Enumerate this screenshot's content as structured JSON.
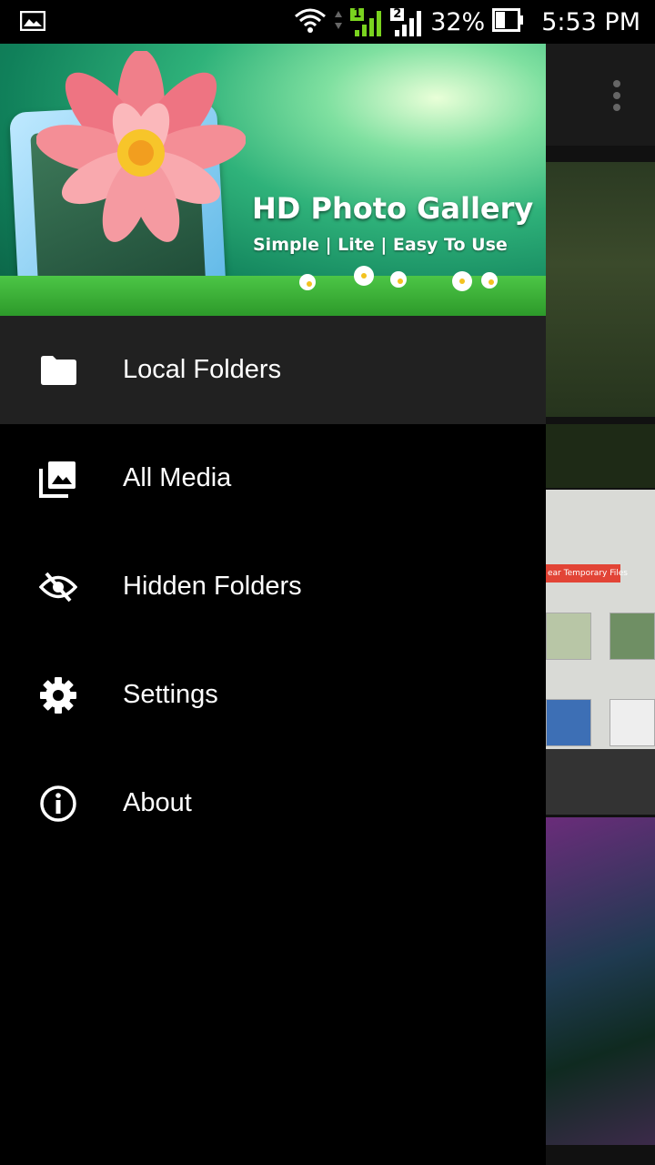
{
  "status_bar": {
    "notification_icon": "image-icon",
    "wifi_icon": "wifi-icon",
    "sim1_label": "1",
    "sim2_label": "2",
    "battery_percent": "32%",
    "time": "5:53 PM",
    "sim1_color": "#7ad31f"
  },
  "drawer": {
    "header": {
      "app_title": "HD Photo Gallery",
      "tagline": "Simple | Lite | Easy To Use"
    },
    "items": [
      {
        "label": "Local Folders",
        "icon": "folder-icon",
        "active": true
      },
      {
        "label": "All Media",
        "icon": "photo-library-icon",
        "active": false
      },
      {
        "label": "Hidden Folders",
        "icon": "eye-off-icon",
        "active": false
      },
      {
        "label": "Settings",
        "icon": "gear-icon",
        "active": false
      },
      {
        "label": "About",
        "icon": "info-icon",
        "active": false
      }
    ]
  },
  "background_app": {
    "tile_badge_text": "ear Temporary Files"
  },
  "colors": {
    "drawer_bg": "#000000",
    "active_item_bg": "#212121",
    "text": "#ffffff"
  }
}
